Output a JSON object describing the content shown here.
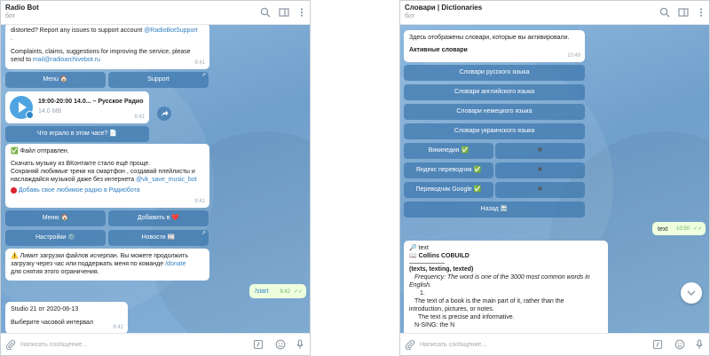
{
  "left": {
    "title": "Radio Bot",
    "subtitle": "бот",
    "input_placeholder": "Написать сообщение...",
    "msg1": {
      "line1": "distorted? Report any issues to support account ",
      "link": "@RadioBotSupport",
      "line2": ".",
      "line3": "Complaints, claims, suggestions for improving the service, please",
      "line4": "send to ",
      "email": "mail@radioarchivebot.ru",
      "time": "9:41"
    },
    "kb1": [
      "Menu 🏠",
      "Support"
    ],
    "audio": {
      "title": "19:00-20:00 14.0... – Русское Радио",
      "size": "14.0 MB",
      "time": "9:41"
    },
    "btn_what": "Что играло в этом часе? 📄",
    "msg2": {
      "line1": "✅ Файл отправлен.",
      "line2": "Скачать музыку из ВКонтакте стало ещё проще.",
      "line3": "Сохраняй  любимые треки на смартфон , создавай плейлисты и",
      "line4": "наслаждайся музыкой даже без интернета ",
      "link1": "@vk_save_music_bot",
      "line5_link": "Добавь свое любимое радио в Радиобота",
      "time": "9:41"
    },
    "kb2": [
      "Меню 🏠",
      "Добавить в ❤️",
      "Настройки ⚙️",
      "Новости 📰"
    ],
    "msg3": {
      "line1": "⚠️ Лимит загрузки файлов исчерпан. Вы можете продолжить",
      "line2": "загрузку через час или поддержать меня по команде ",
      "link": "/donate",
      "line3": "для снятия этого ограничения."
    },
    "out": {
      "text": "/start",
      "time": "9:42"
    },
    "msg4": {
      "line1": "Studio 21 от 2020-06-13",
      "line2": "Выберите часовой интервал",
      "time": "9:42"
    }
  },
  "right": {
    "title": "Словари | Dictionaries",
    "subtitle": "бот",
    "input_placeholder": "Написать сообщение...",
    "msg1": {
      "line1": "Здесь отображены словари, которые вы активировали.",
      "line2": "Активные словари",
      "time": "10:49"
    },
    "dict_buttons": [
      "Словари русского языка",
      "Словари английского языка",
      "Словари немецкого языка",
      "Словари украинского языка"
    ],
    "toggles": [
      {
        "left": "Википедия ✅",
        "right": "✖"
      },
      {
        "left": "Яндекс переводчик ✅",
        "right": "✖"
      },
      {
        "left": "Переводчик Google ✅",
        "right": "✖"
      }
    ],
    "back": "Назад 🔙",
    "out": {
      "text": "text",
      "time": "10:50"
    },
    "msg2": {
      "line1": "🔎 text",
      "line2": "📖 Collins COBUILD",
      "line3": "(texts, texting, texted)",
      "line4": "Frequency: The word is one of the 3000 most common words in",
      "line5": "English.",
      "line6": "1.",
      "line7": "The text of a book is the main part of it, rather than the",
      "line8": "introduction, pictures, or notes.",
      "line9": "The text is precise and informative.",
      "line10": "N-SING: the N"
    }
  }
}
